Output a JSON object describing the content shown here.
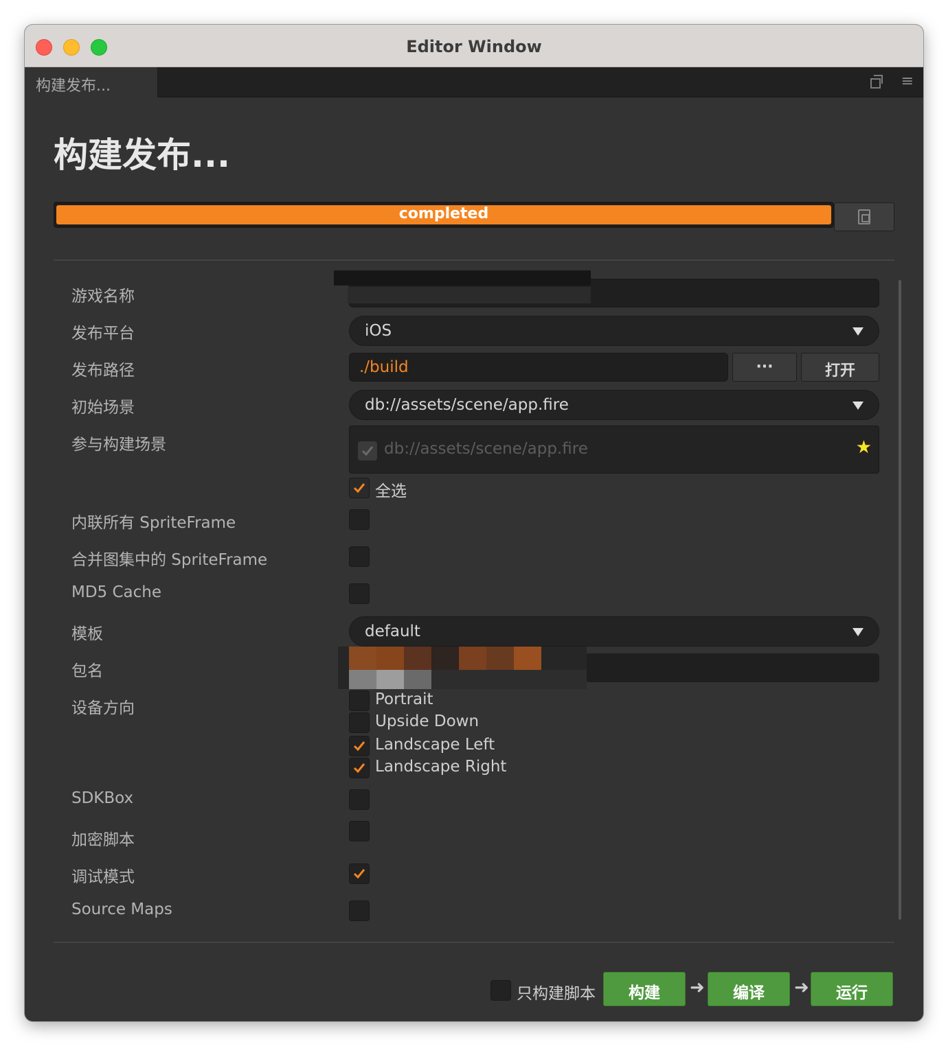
{
  "window": {
    "title": "Editor Window"
  },
  "tab": {
    "label": "构建发布...",
    "popout_icon": "popout-icon",
    "menu_icon": "menu-icon"
  },
  "page": {
    "title": "构建发布..."
  },
  "progress": {
    "status_text": "completed",
    "fraction": 1.0,
    "color": "#f58520"
  },
  "fields": {
    "game_name": {
      "label": "游戏名称",
      "value": ""
    },
    "platform": {
      "label": "发布平台",
      "value": "iOS"
    },
    "build_path": {
      "label": "发布路径",
      "value": "./build",
      "browse_label": "···",
      "open_label": "打开"
    },
    "start_scene": {
      "label": "初始场景",
      "value": "db://assets/scene/app.fire"
    },
    "included_scenes": {
      "label": "参与构建场景",
      "items": [
        "db://assets/scene/app.fire"
      ],
      "select_all_label": "全选",
      "select_all_checked": true
    },
    "inline_spriteframes": {
      "label": "内联所有 SpriteFrame",
      "checked": false
    },
    "merge_spriteframes": {
      "label": "合并图集中的 SpriteFrame",
      "checked": false
    },
    "md5_cache": {
      "label": "MD5 Cache",
      "checked": false
    },
    "template": {
      "label": "模板",
      "value": "default"
    },
    "package_name": {
      "label": "包名",
      "value": ""
    },
    "orientation": {
      "label": "设备方向",
      "options": [
        {
          "label": "Portrait",
          "checked": false
        },
        {
          "label": "Upside Down",
          "checked": false
        },
        {
          "label": "Landscape Left",
          "checked": true
        },
        {
          "label": "Landscape Right",
          "checked": true
        }
      ]
    },
    "sdkbox": {
      "label": "SDKBox",
      "checked": false
    },
    "encrypt_js": {
      "label": "加密脚本",
      "checked": false
    },
    "debug_mode": {
      "label": "调试模式",
      "checked": true
    },
    "source_maps": {
      "label": "Source Maps",
      "checked": false
    }
  },
  "footer": {
    "build_scripts_only_label": "只构建脚本",
    "build_scripts_only_checked": false,
    "build_label": "构建",
    "compile_label": "编译",
    "run_label": "运行"
  },
  "colors": {
    "accent": "#f58520",
    "action_green": "#4f9a3f",
    "background": "#333333"
  }
}
